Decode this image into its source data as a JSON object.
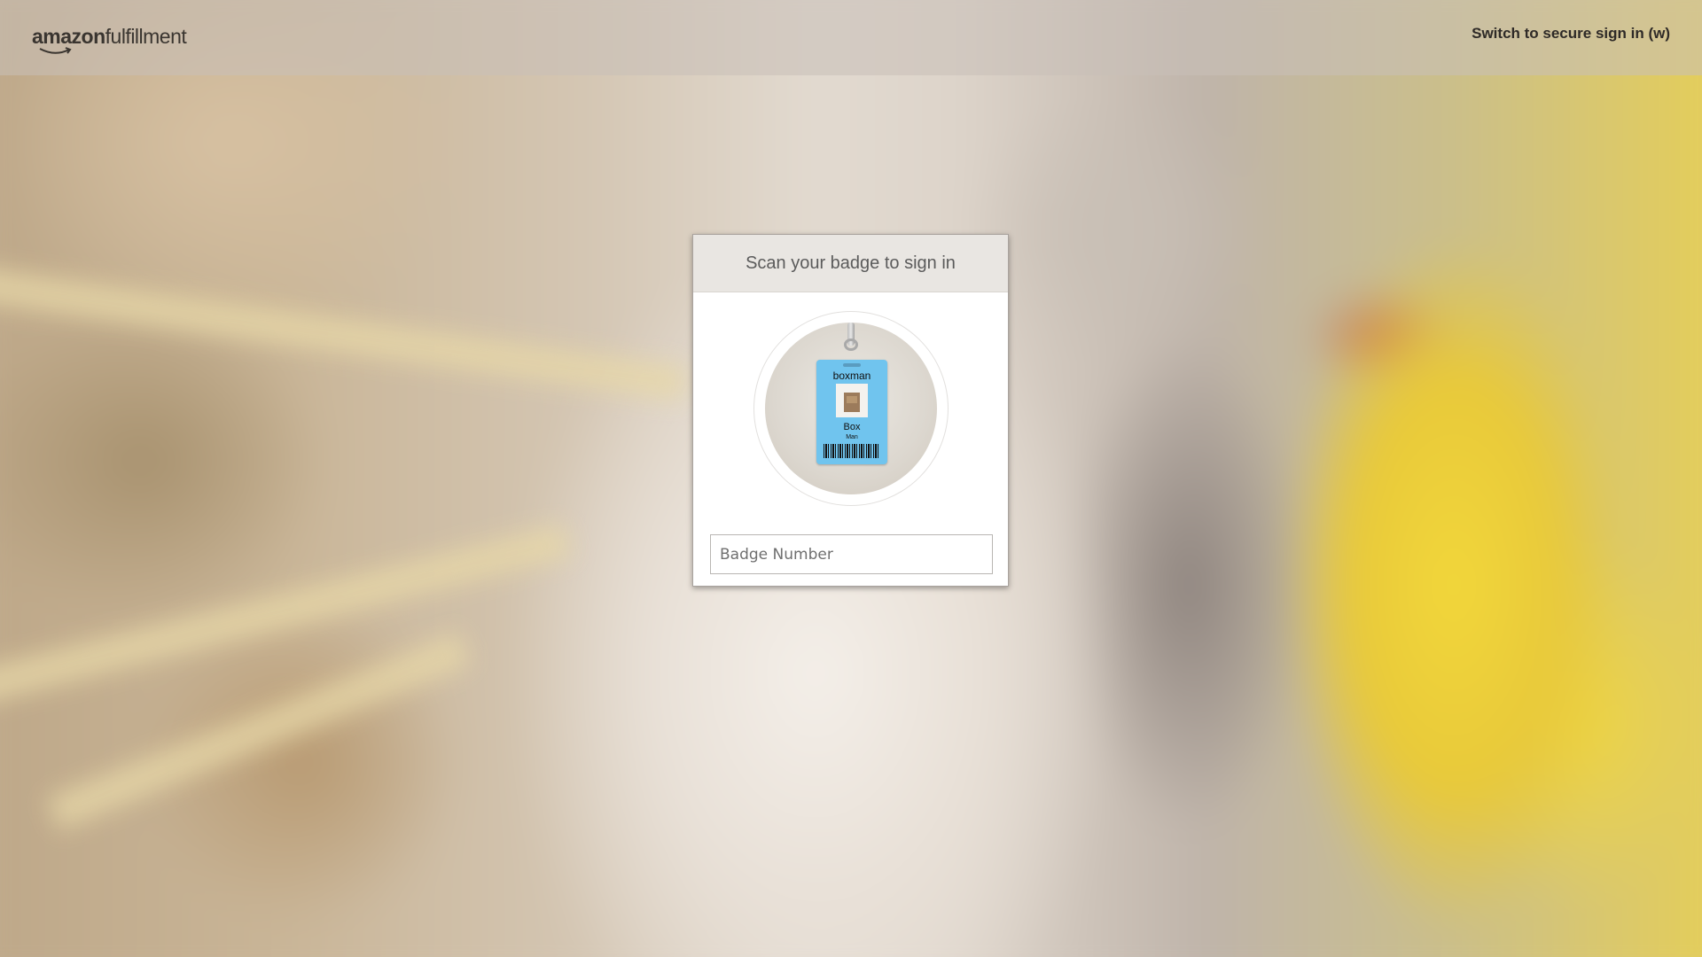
{
  "header": {
    "logo_brand": "amazon",
    "logo_suffix": "fulfillment",
    "switch_link": "Switch to secure sign in (w)"
  },
  "login_card": {
    "title": "Scan your badge to sign in",
    "badge_illustration": {
      "username": "boxman",
      "first_name": "Box",
      "last_name": "Man"
    },
    "badge_input": {
      "value": "",
      "placeholder": "Badge Number"
    }
  },
  "colors": {
    "badge_blue": "#70c4ee",
    "card_header_bg": "#e9e6e2",
    "title_text": "#5b5b5b"
  },
  "icons": [
    "amazon-smile-logo",
    "badge-illustration",
    "barcode"
  ]
}
